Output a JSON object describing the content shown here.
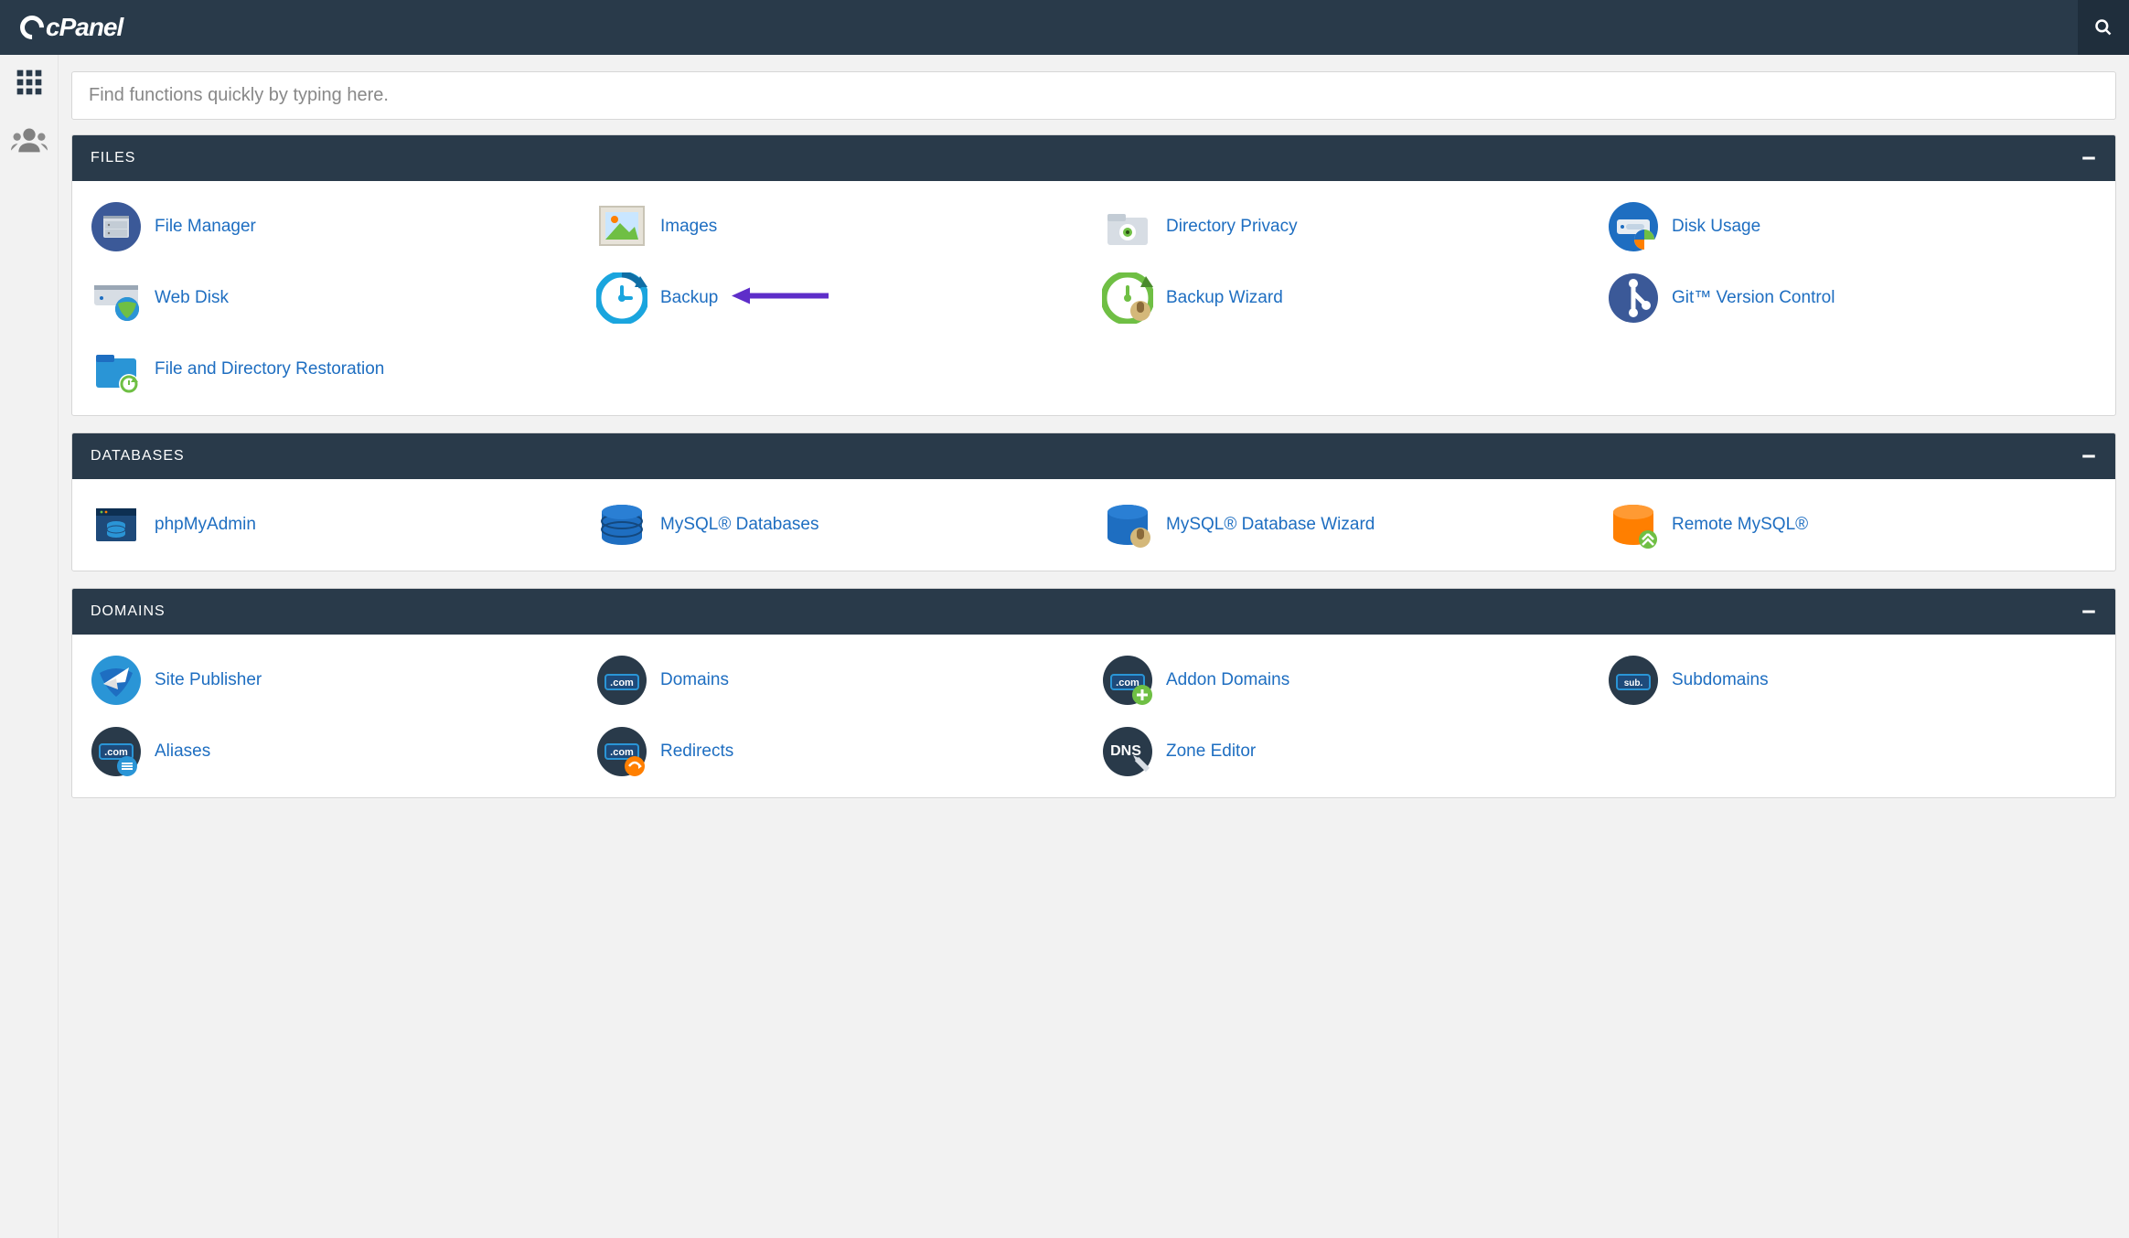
{
  "brand": "cPanel",
  "search": {
    "placeholder": "Find functions quickly by typing here."
  },
  "sections": [
    {
      "key": "files",
      "title": "FILES",
      "items": [
        {
          "key": "file-manager",
          "label": "File Manager"
        },
        {
          "key": "images",
          "label": "Images"
        },
        {
          "key": "directory-privacy",
          "label": "Directory Privacy"
        },
        {
          "key": "disk-usage",
          "label": "Disk Usage"
        },
        {
          "key": "web-disk",
          "label": "Web Disk"
        },
        {
          "key": "backup",
          "label": "Backup",
          "annotated": true
        },
        {
          "key": "backup-wizard",
          "label": "Backup Wizard"
        },
        {
          "key": "git-version-control",
          "label": "Git™ Version Control"
        },
        {
          "key": "file-directory-restoration",
          "label": "File and Directory Restoration"
        }
      ]
    },
    {
      "key": "databases",
      "title": "DATABASES",
      "items": [
        {
          "key": "phpmyadmin",
          "label": "phpMyAdmin"
        },
        {
          "key": "mysql-databases",
          "label": "MySQL® Databases"
        },
        {
          "key": "mysql-database-wizard",
          "label": "MySQL® Database Wizard"
        },
        {
          "key": "remote-mysql",
          "label": "Remote MySQL®"
        }
      ]
    },
    {
      "key": "domains",
      "title": "DOMAINS",
      "items": [
        {
          "key": "site-publisher",
          "label": "Site Publisher"
        },
        {
          "key": "domains",
          "label": "Domains"
        },
        {
          "key": "addon-domains",
          "label": "Addon Domains"
        },
        {
          "key": "subdomains",
          "label": "Subdomains"
        },
        {
          "key": "aliases",
          "label": "Aliases"
        },
        {
          "key": "redirects",
          "label": "Redirects"
        },
        {
          "key": "zone-editor",
          "label": "Zone Editor"
        }
      ]
    }
  ],
  "colors": {
    "accent": "#1e6ec1",
    "header": "#293a4a",
    "arrow": "#5e2ec9"
  }
}
